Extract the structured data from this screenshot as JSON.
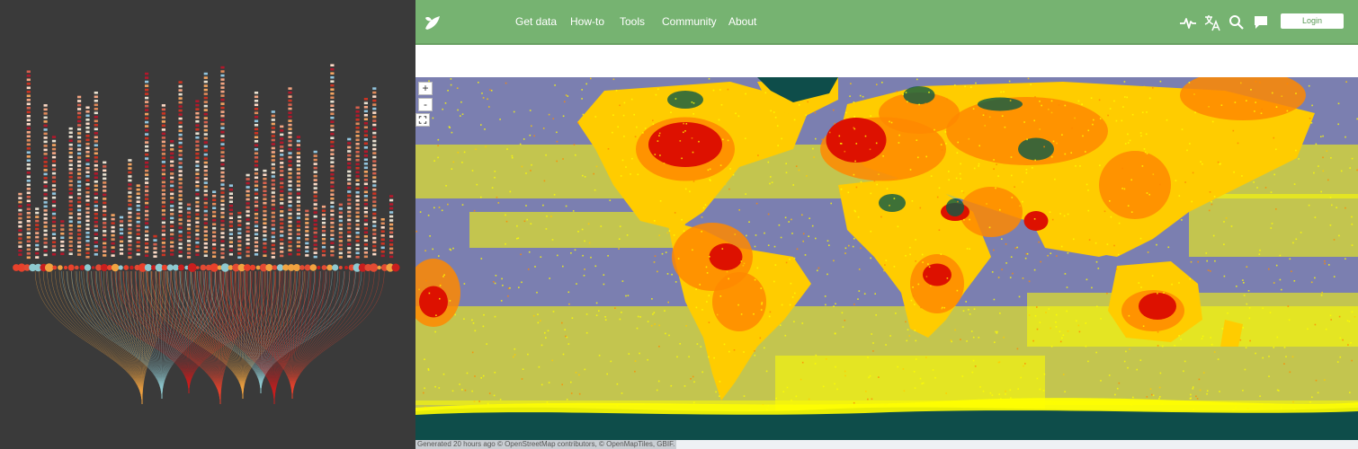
{
  "viz": {
    "background": "#3a3a3a",
    "palette": [
      "#f4a582",
      "#d6604d",
      "#b2182b",
      "#e8e0d0",
      "#fddbc7",
      "#92c5de",
      "#f4a460",
      "#cc3322",
      "#e08a5a"
    ],
    "node_palette": [
      "#e8412b",
      "#c81e1e",
      "#8ec9d0",
      "#f1a340",
      "#e24a33"
    ],
    "fan_colors": [
      "#f1a340",
      "#8ec9d0",
      "#c81e1e",
      "#e8412b"
    ],
    "columns": [
      0.32,
      0.9,
      0.25,
      0.74,
      0.59,
      0.19,
      0.63,
      0.78,
      0.73,
      0.8,
      0.47,
      0.22,
      0.21,
      0.48,
      0.36,
      0.89,
      0.12,
      0.74,
      0.57,
      0.85,
      0.27,
      0.76,
      0.89,
      0.33,
      0.92,
      0.36,
      0.23,
      0.41,
      0.8,
      0.43,
      0.71,
      0.64,
      0.82,
      0.59,
      0.24,
      0.52,
      0.26,
      0.93,
      0.27,
      0.58,
      0.73,
      0.77,
      0.82,
      0.2,
      0.31
    ],
    "fans": [
      {
        "color_index": 0,
        "from": [
          0.02,
          0.45
        ]
      },
      {
        "color_index": 1,
        "from": [
          0.1,
          0.55
        ]
      },
      {
        "color_index": 2,
        "from": [
          0.3,
          0.7
        ]
      },
      {
        "color_index": 3,
        "from": [
          0.45,
          0.85
        ]
      },
      {
        "color_index": 2,
        "from": [
          0.5,
          0.92
        ]
      },
      {
        "color_index": 0,
        "from": [
          0.4,
          0.8
        ]
      },
      {
        "color_index": 1,
        "from": [
          0.35,
          0.95
        ]
      },
      {
        "color_index": 0,
        "from": [
          0.55,
          0.98
        ]
      },
      {
        "color_index": 2,
        "from": [
          0.65,
          1.0
        ]
      }
    ]
  },
  "site": {
    "nav": {
      "logo_icon": "leaf-logo-icon",
      "links": [
        {
          "label": "Get data"
        },
        {
          "label": "How-to"
        },
        {
          "label": "Tools"
        },
        {
          "label": "Community"
        },
        {
          "label": "About"
        }
      ],
      "icons": [
        "activity-icon",
        "translate-icon",
        "search-icon",
        "chat-icon"
      ],
      "login_label": "Login",
      "color": "#76b371"
    },
    "map": {
      "zoom_in": "+",
      "zoom_out": "-",
      "fullscreen_icon": "fullscreen-icon",
      "colors": {
        "ocean": "#7b7fb0",
        "ice": "#0e4d4a",
        "low": "#ffff00",
        "mid": "#ffcc00",
        "high": "#ff8800",
        "max": "#dd1100",
        "forest": "#0e5a45"
      }
    },
    "attribution": "Generated 20 hours ago © OpenStreetMap contributors, © OpenMapTiles, GBIF."
  }
}
